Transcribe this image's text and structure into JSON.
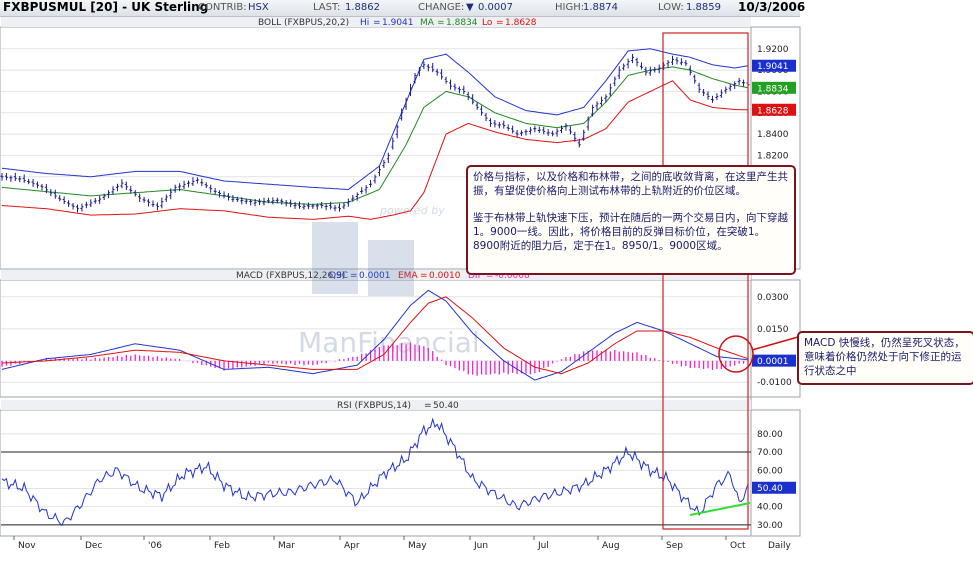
{
  "header": {
    "symbol": "FXBPUSMUL [20] - UK Sterling",
    "contrib_label": "CONTRIB:",
    "contrib_value": "HSX",
    "last_label": "LAST:",
    "last_value": "1.8862",
    "change_label": "CHANGE:",
    "change_arrow": "▼",
    "change_value": "0.0007",
    "high_label": "HIGH:",
    "high_value": "1.8874",
    "low_label": "LOW:",
    "low_value": "1.8859",
    "date": "10/3/2006"
  },
  "watermark": {
    "line1": "ManFinancial",
    "line2": "powered by"
  },
  "annotations": {
    "note1_p1": "价格与指标，以及价格和布林带，之间的底收敛背离，在这里产生共振，有望促使价格向上测试布林带的上轨附近的价位区域。",
    "note1_p2": "鉴于布林带上轨快速下压，预计在随后的一两个交易日内，向下穿越1。9000一线。因此，将价格目前的反弹目标价位，在突破1。8900附近的阻力后，定于在1。8950/1。9000区域。",
    "note2": "MACD 快慢线，仍然呈死叉状态，意味着价格仍然处于向下修正的运行状态之中"
  },
  "colors": {
    "price": "#1a1a8c",
    "upper_band": "#2233cc",
    "middle_band": "#228822",
    "lower_band": "#dd1111",
    "macd": "#2233cc",
    "ema": "#dd1111",
    "histogram": "#ee22cc",
    "rsi": "#2233cc",
    "highlight_box": "#cc2222",
    "trendline": "#33dd33"
  },
  "chart_data": [
    {
      "type": "line",
      "panel": "price",
      "title": "BOLL (FXBPUS,20,2)",
      "legend": [
        {
          "name": "Hi",
          "value": "1.9041"
        },
        {
          "name": "MA",
          "value": "1.8834"
        },
        {
          "name": "Lo",
          "value": "1.8628"
        }
      ],
      "x_labels": [
        "Nov",
        "Dec",
        "'06",
        "Feb",
        "Mar",
        "Apr",
        "May",
        "Jun",
        "Jul",
        "Aug",
        "Sep",
        "Oct",
        "Daily"
      ],
      "y_ticks": [
        "1.9200",
        "1.9000",
        "1.8800",
        "1.8600",
        "1.8400",
        "1.8200",
        "1.8000"
      ],
      "ylim": [
        1.72,
        1.932
      ],
      "value_tags": [
        "1.9041",
        "1.8834",
        "1.8628"
      ],
      "series": [
        {
          "name": "Price",
          "anchors": [
            [
              0,
              1.7999
            ],
            [
              8,
              1.798
            ],
            [
              18,
              1.7905
            ],
            [
              26,
              1.779
            ],
            [
              34,
              1.77
            ],
            [
              44,
              1.779
            ],
            [
              54,
              1.794
            ],
            [
              62,
              1.78
            ],
            [
              70,
              1.772
            ],
            [
              78,
              1.79
            ],
            [
              88,
              1.797
            ],
            [
              96,
              1.786
            ],
            [
              104,
              1.779
            ],
            [
              114,
              1.776
            ],
            [
              124,
              1.778
            ],
            [
              134,
              1.772
            ],
            [
              144,
              1.773
            ],
            [
              152,
              1.77
            ],
            [
              158,
              1.78
            ],
            [
              166,
              1.793
            ],
            [
              174,
              1.82
            ],
            [
              180,
              1.86
            ],
            [
              186,
              1.895
            ],
            [
              190,
              1.905
            ],
            [
              196,
              1.898
            ],
            [
              202,
              1.885
            ],
            [
              208,
              1.88
            ],
            [
              214,
              1.865
            ],
            [
              220,
              1.85
            ],
            [
              226,
              1.848
            ],
            [
              232,
              1.84
            ],
            [
              240,
              1.845
            ],
            [
              248,
              1.84
            ],
            [
              254,
              1.848
            ],
            [
              260,
              1.83
            ],
            [
              266,
              1.865
            ],
            [
              272,
              1.875
            ],
            [
              278,
              1.9
            ],
            [
              284,
              1.912
            ],
            [
              290,
              1.898
            ],
            [
              296,
              1.902
            ],
            [
              302,
              1.91
            ],
            [
              308,
              1.906
            ],
            [
              314,
              1.882
            ],
            [
              320,
              1.872
            ],
            [
              326,
              1.882
            ],
            [
              332,
              1.89
            ],
            [
              336,
              1.8862
            ]
          ]
        },
        {
          "name": "Upper band",
          "anchors": [
            [
              0,
              1.808
            ],
            [
              20,
              1.803
            ],
            [
              40,
              1.8
            ],
            [
              60,
              1.805
            ],
            [
              80,
              1.805
            ],
            [
              100,
              1.796
            ],
            [
              120,
              1.793
            ],
            [
              140,
              1.79
            ],
            [
              156,
              1.788
            ],
            [
              170,
              1.81
            ],
            [
              182,
              1.87
            ],
            [
              190,
              1.91
            ],
            [
              200,
              1.915
            ],
            [
              210,
              1.898
            ],
            [
              222,
              1.875
            ],
            [
              236,
              1.862
            ],
            [
              250,
              1.858
            ],
            [
              262,
              1.865
            ],
            [
              272,
              1.89
            ],
            [
              282,
              1.918
            ],
            [
              292,
              1.92
            ],
            [
              302,
              1.915
            ],
            [
              310,
              1.912
            ],
            [
              320,
              1.905
            ],
            [
              330,
              1.902
            ],
            [
              336,
              1.9041
            ]
          ]
        },
        {
          "name": "Middle band",
          "anchors": [
            [
              0,
              1.79
            ],
            [
              20,
              1.786
            ],
            [
              40,
              1.782
            ],
            [
              60,
              1.785
            ],
            [
              80,
              1.788
            ],
            [
              100,
              1.782
            ],
            [
              120,
              1.776
            ],
            [
              140,
              1.774
            ],
            [
              156,
              1.776
            ],
            [
              170,
              1.788
            ],
            [
              182,
              1.83
            ],
            [
              190,
              1.865
            ],
            [
              200,
              1.88
            ],
            [
              210,
              1.875
            ],
            [
              222,
              1.86
            ],
            [
              236,
              1.85
            ],
            [
              250,
              1.846
            ],
            [
              262,
              1.85
            ],
            [
              272,
              1.87
            ],
            [
              282,
              1.895
            ],
            [
              292,
              1.9
            ],
            [
              302,
              1.903
            ],
            [
              310,
              1.9
            ],
            [
              320,
              1.892
            ],
            [
              330,
              1.886
            ],
            [
              336,
              1.8834
            ]
          ]
        },
        {
          "name": "Lower band",
          "anchors": [
            [
              0,
              1.773
            ],
            [
              20,
              1.77
            ],
            [
              40,
              1.764
            ],
            [
              60,
              1.765
            ],
            [
              80,
              1.77
            ],
            [
              100,
              1.768
            ],
            [
              120,
              1.762
            ],
            [
              140,
              1.76
            ],
            [
              156,
              1.763
            ],
            [
              166,
              1.76
            ],
            [
              176,
              1.764
            ],
            [
              184,
              1.768
            ],
            [
              190,
              1.785
            ],
            [
              200,
              1.84
            ],
            [
              210,
              1.85
            ],
            [
              222,
              1.842
            ],
            [
              236,
              1.835
            ],
            [
              250,
              1.832
            ],
            [
              262,
              1.835
            ],
            [
              272,
              1.845
            ],
            [
              282,
              1.87
            ],
            [
              292,
              1.88
            ],
            [
              302,
              1.89
            ],
            [
              310,
              1.872
            ],
            [
              320,
              1.865
            ],
            [
              330,
              1.863
            ],
            [
              336,
              1.8628
            ]
          ]
        }
      ]
    },
    {
      "type": "line",
      "panel": "macd",
      "title": "MACD (FXBPUS,12,26,9)",
      "legend": [
        {
          "name": "OSC",
          "value": "0.0001"
        },
        {
          "name": "EMA",
          "value": "0.0010"
        },
        {
          "name": "DIF",
          "value": "-0.0008"
        }
      ],
      "y_ticks": [
        "0.0300",
        "0.0150",
        "0.0000",
        "-0.0100"
      ],
      "ylim": [
        -0.016,
        0.036
      ],
      "value_tags": [
        "0.0001"
      ],
      "series": [
        {
          "name": "MACD",
          "anchors": [
            [
              0,
              -0.004
            ],
            [
              20,
              0.001
            ],
            [
              40,
              0.003
            ],
            [
              60,
              0.008
            ],
            [
              80,
              0.005
            ],
            [
              100,
              -0.004
            ],
            [
              120,
              -0.003
            ],
            [
              140,
              -0.006
            ],
            [
              160,
              -0.002
            ],
            [
              172,
              0.01
            ],
            [
              184,
              0.026
            ],
            [
              192,
              0.033
            ],
            [
              200,
              0.028
            ],
            [
              212,
              0.013
            ],
            [
              226,
              0.0
            ],
            [
              240,
              -0.009
            ],
            [
              252,
              -0.005
            ],
            [
              264,
              0.004
            ],
            [
              276,
              0.013
            ],
            [
              286,
              0.018
            ],
            [
              298,
              0.014
            ],
            [
              310,
              0.008
            ],
            [
              322,
              0.002
            ],
            [
              336,
              0.0005
            ]
          ]
        },
        {
          "name": "EMA",
          "anchors": [
            [
              0,
              -0.001
            ],
            [
              20,
              0.0
            ],
            [
              40,
              0.002
            ],
            [
              60,
              0.005
            ],
            [
              80,
              0.004
            ],
            [
              100,
              0.0
            ],
            [
              120,
              -0.002
            ],
            [
              140,
              -0.004
            ],
            [
              160,
              -0.004
            ],
            [
              172,
              0.003
            ],
            [
              184,
              0.018
            ],
            [
              192,
              0.027
            ],
            [
              200,
              0.03
            ],
            [
              212,
              0.02
            ],
            [
              226,
              0.006
            ],
            [
              240,
              -0.003
            ],
            [
              252,
              -0.006
            ],
            [
              264,
              -0.001
            ],
            [
              276,
              0.008
            ],
            [
              286,
              0.014
            ],
            [
              298,
              0.014
            ],
            [
              310,
              0.011
            ],
            [
              322,
              0.006
            ],
            [
              336,
              0.001
            ]
          ]
        }
      ]
    },
    {
      "type": "line",
      "panel": "rsi",
      "title": "RSI (FXBPUS,14)",
      "legend": [
        {
          "name": "",
          "value": "50.40"
        }
      ],
      "y_ticks": [
        "80.00",
        "70.00",
        "60.00",
        "50.00",
        "40.00",
        "30.00"
      ],
      "ylim": [
        25,
        92
      ],
      "reference_lines": [
        70,
        30
      ],
      "value_tags": [
        "50.40"
      ],
      "series": [
        {
          "name": "RSI",
          "anchors": [
            [
              0,
              54
            ],
            [
              10,
              50
            ],
            [
              20,
              36
            ],
            [
              28,
              31
            ],
            [
              36,
              42
            ],
            [
              44,
              55
            ],
            [
              52,
              60
            ],
            [
              62,
              50
            ],
            [
              72,
              46
            ],
            [
              82,
              58
            ],
            [
              92,
              62
            ],
            [
              100,
              52
            ],
            [
              110,
              45
            ],
            [
              120,
              47
            ],
            [
              130,
              48
            ],
            [
              140,
              52
            ],
            [
              150,
              55
            ],
            [
              160,
              42
            ],
            [
              172,
              58
            ],
            [
              182,
              66
            ],
            [
              190,
              82
            ],
            [
              196,
              86
            ],
            [
              204,
              72
            ],
            [
              212,
              55
            ],
            [
              222,
              47
            ],
            [
              232,
              40
            ],
            [
              242,
              45
            ],
            [
              252,
              48
            ],
            [
              262,
              52
            ],
            [
              272,
              60
            ],
            [
              282,
              70
            ],
            [
              292,
              60
            ],
            [
              300,
              55
            ],
            [
              306,
              46
            ],
            [
              314,
              36
            ],
            [
              322,
              52
            ],
            [
              328,
              58
            ],
            [
              332,
              42
            ],
            [
              336,
              50.4
            ]
          ]
        }
      ]
    }
  ]
}
